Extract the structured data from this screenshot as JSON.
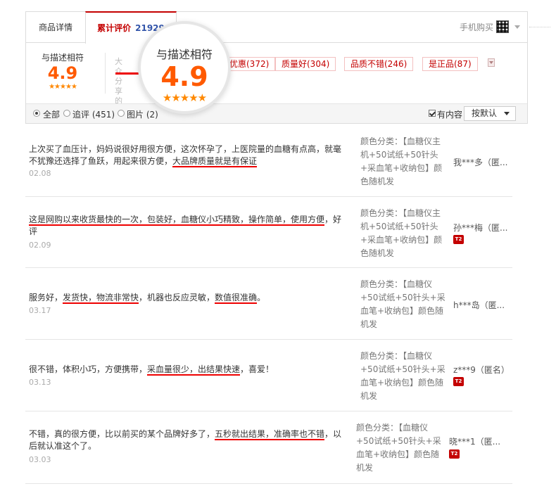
{
  "tabs": {
    "detail": "商品详情",
    "reviews": "累计评价",
    "review_count": "21929",
    "mobile_buy": "手机购买"
  },
  "score": {
    "label": "与描述相符",
    "value": "4.9",
    "stars": "★★★★★"
  },
  "magnifier": {
    "label": "与描述相符",
    "value": "4.9",
    "stars": "★★★★★"
  },
  "ghost_text": "大众分享的",
  "tags": [
    "优惠(372)",
    "质量好(304)",
    "品质不错(246)",
    "是正品(87)"
  ],
  "filter": {
    "all": "全部",
    "followup": "追评 (451)",
    "pictures": "图片 (2)",
    "has_content": "有内容",
    "sort": "按默认"
  },
  "colors": {
    "accent": "#c40000",
    "score": "#ff5a00",
    "underline": "#ee0000"
  },
  "reviews": [
    {
      "pre": "上次买了血压计，妈妈说很好用很方便，这次怀孕了，上医院量的血糖有点高，就毫不犹豫还选择了鱼跃，用起来很方便，",
      "hl1": "大品牌质量就是有保证",
      "mid": "",
      "hl2": "",
      "post": "",
      "date": "02.08",
      "sku": "颜色分类：【血糖仪主机+50试纸+50针头+采血笔+收纳包】颜色随机发",
      "user": "我***多（匿...",
      "badge": ""
    },
    {
      "pre": "",
      "hl1": "这是网购以来收货最快的一次，包装好，血糖仪小巧精致，操作简单，使用方便",
      "mid": "",
      "hl2": "",
      "post": "，好评",
      "date": "02.09",
      "sku": "颜色分类：【血糖仪主机+50试纸+50针头+采血笔+收纳包】颜色随机发",
      "user": "孙***梅（匿...",
      "badge": "T2"
    },
    {
      "pre": "服务好，",
      "hl1": "发货快，物流非常快",
      "mid": "，机器也反应灵敏，",
      "hl2": "数值很准确",
      "post": "。",
      "date": "03.17",
      "sku": "颜色分类：【血糖仪+50试纸+50针头+采血笔+收纳包】颜色随机发",
      "user": "h***岛（匿...",
      "badge": ""
    },
    {
      "pre": "很不错，体积小巧，方便携带，",
      "hl1": "采血量很少，出结果快速",
      "mid": "",
      "hl2": "",
      "post": "，喜爱！",
      "date": "03.13",
      "sku": "颜色分类：【血糖仪+50试纸+50针头+采血笔+收纳包】颜色随机发",
      "user": "z***9（匿名）",
      "badge": "T2"
    },
    {
      "pre": "不错，真的很方便，比以前买的某个品牌好多了，",
      "hl1": "五秒就出结果，准确率也不错",
      "mid": "",
      "hl2": "",
      "post": "，以后就认准这个了。",
      "date": "03.03",
      "sku": "颜色分类：【血糖仪+50试纸+50针头+采血笔+收纳包】颜色随机发",
      "user": "晓***1（匿...",
      "badge": "T2"
    }
  ]
}
